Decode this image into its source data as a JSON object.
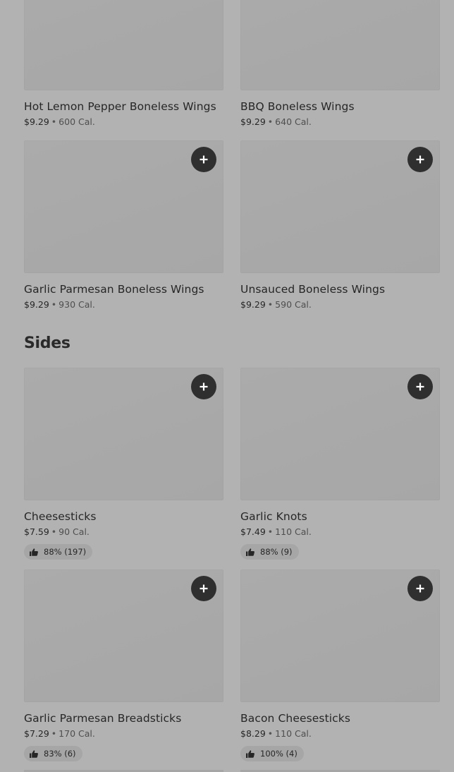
{
  "items_top": [
    {
      "name": "Hot Lemon Pepper Boneless Wings",
      "price": "$9.29",
      "cal": "600 Cal."
    },
    {
      "name": "BBQ Boneless Wings",
      "price": "$9.29",
      "cal": "640 Cal."
    },
    {
      "name": "Garlic Parmesan Boneless Wings",
      "price": "$9.29",
      "cal": "930 Cal."
    },
    {
      "name": "Unsauced Boneless Wings",
      "price": "$9.29",
      "cal": "590 Cal."
    }
  ],
  "sides": {
    "title": "Sides",
    "items": [
      {
        "name": "Cheesesticks",
        "price": "$7.59",
        "cal": "90 Cal.",
        "rating": "88% (197)"
      },
      {
        "name": "Garlic Knots",
        "price": "$7.49",
        "cal": "110 Cal.",
        "rating": "88% (9)"
      },
      {
        "name": "Garlic Parmesan Breadsticks",
        "price": "$7.29",
        "cal": "170 Cal.",
        "rating": "83% (6)"
      },
      {
        "name": "Bacon Cheesesticks",
        "price": "$8.29",
        "cal": "110 Cal.",
        "rating": "100% (4)"
      }
    ]
  },
  "separator": "•",
  "icons": {
    "add": "plus-icon",
    "rating": "thumbs-up-icon"
  },
  "colors": {
    "background": "#b2b2b2",
    "image_placeholder": "#a9a9a9",
    "add_button": "#2f2f2f",
    "text": "#262626"
  }
}
